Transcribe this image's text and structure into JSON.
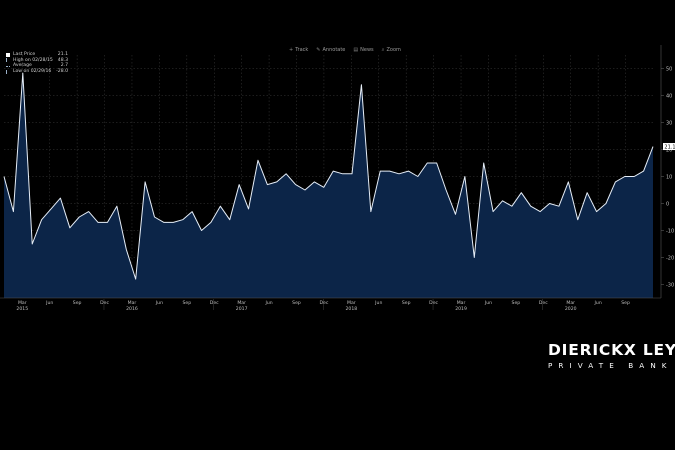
{
  "toolbar": {
    "items": [
      {
        "label": "Track",
        "icon": "crosshair-icon"
      },
      {
        "label": "Annotate",
        "icon": "pencil-icon"
      },
      {
        "label": "News",
        "icon": "news-icon"
      },
      {
        "label": "Zoom",
        "icon": "magnifier-icon"
      }
    ]
  },
  "legend": {
    "rows": [
      {
        "label": "Last Price",
        "value": "21.1",
        "swatch": "#ffffff"
      },
      {
        "label": "High on 02/28/15",
        "value": "48.3",
        "swatch": "#9ab0c8"
      },
      {
        "label": "Average",
        "value": "2.7",
        "swatch": "#9ab0c8"
      },
      {
        "label": "Low on 02/29/16",
        "value": "-28.0",
        "swatch": "#9ab0c8"
      }
    ]
  },
  "brand": {
    "name": "DIERICKX LEYS",
    "subtitle": "PRIVATE BANK"
  },
  "chart_data": {
    "type": "area",
    "ylim": [
      -35,
      55
    ],
    "yticks": [
      -30,
      -20,
      -10,
      0,
      10,
      20,
      30,
      40,
      50
    ],
    "grid": true,
    "last_value_label": "21.1",
    "colors": {
      "fill": "#0c2548",
      "line": "#e6eef8",
      "grid": "#3a3a3a",
      "axis_text": "#bfbfbf"
    },
    "x_month_labels": [
      "Mar",
      "Jun",
      "Sep",
      "Dec",
      "Mar",
      "Jun",
      "Sep",
      "Dec",
      "Mar",
      "Jun",
      "Sep",
      "Dec",
      "Mar",
      "Jun",
      "Sep",
      "Dec",
      "Mar",
      "Jun",
      "Sep",
      "Dec",
      "Mar",
      "Jun",
      "Sep"
    ],
    "x_year_labels": [
      {
        "label": "2015",
        "month_index": 0
      },
      {
        "label": "2016",
        "month_index": 4
      },
      {
        "label": "2017",
        "month_index": 8
      },
      {
        "label": "2018",
        "month_index": 12
      },
      {
        "label": "2019",
        "month_index": 16
      },
      {
        "label": "2020",
        "month_index": 20
      }
    ],
    "x_start": "Jan 2015",
    "x_end": "Nov 2020",
    "y": [
      10,
      -3,
      48.3,
      -15,
      -6,
      -2,
      2,
      -9,
      -5,
      -3,
      -7,
      -7,
      -1,
      -17,
      -28,
      8,
      -5,
      -7,
      -7,
      -6,
      -3,
      -10,
      -7,
      -1,
      -6,
      7,
      -2,
      16,
      7,
      8,
      11,
      7,
      5,
      8,
      6,
      12,
      11,
      11,
      44,
      -3,
      12,
      12,
      11,
      12,
      10,
      15,
      15,
      5,
      -4,
      10,
      -20,
      15,
      -3,
      1,
      -1,
      4,
      -1,
      -3,
      0,
      -1,
      8,
      -6,
      4,
      -3,
      0,
      8,
      10,
      10,
      12,
      21.1
    ]
  }
}
